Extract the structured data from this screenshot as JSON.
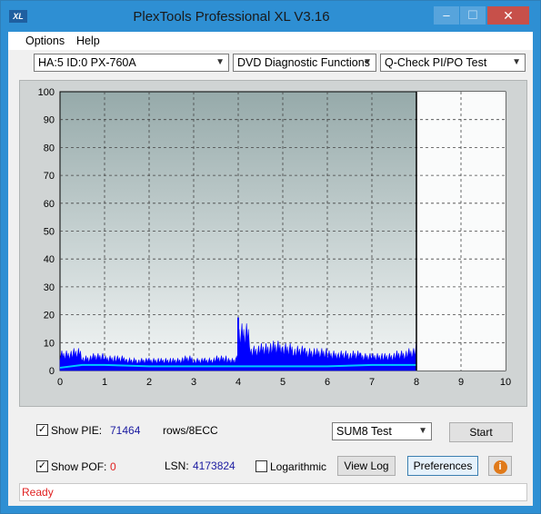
{
  "window": {
    "title": "PlexTools Professional XL V3.16",
    "icon_text": "XL"
  },
  "title_controls": {
    "minimize": "–",
    "maximize": "☐",
    "close": "✕"
  },
  "menu": {
    "options": "Options",
    "help": "Help"
  },
  "combos": {
    "drive": "HA:5 ID:0  PX-760A",
    "function": "DVD Diagnostic Functions",
    "test": "Q-Check PI/PO Test"
  },
  "chart_data": {
    "type": "area",
    "title": "",
    "xlabel": "",
    "ylabel": "",
    "xlim": [
      0,
      10
    ],
    "ylim": [
      0,
      100
    ],
    "x_ticks": [
      "0",
      "1",
      "2",
      "3",
      "4",
      "5",
      "6",
      "7",
      "8",
      "9",
      "10"
    ],
    "y_ticks": [
      "0",
      "10",
      "20",
      "30",
      "40",
      "50",
      "60",
      "70",
      "80",
      "90",
      "100"
    ],
    "grid": true,
    "end_marker_x": 8,
    "series": [
      {
        "color": "#0000ff",
        "x": [
          0.0,
          0.25,
          0.5,
          0.75,
          1.0,
          1.25,
          1.5,
          1.75,
          2.0,
          2.25,
          2.5,
          2.75,
          3.0,
          3.25,
          3.5,
          3.75,
          3.95,
          4.0,
          4.25,
          4.5,
          4.75,
          5.0,
          5.25,
          5.5,
          5.75,
          6.0,
          6.25,
          6.5,
          6.75,
          7.0,
          7.25,
          7.5,
          7.75,
          8.0
        ],
        "values": [
          8,
          9,
          6,
          7,
          6,
          6,
          5,
          5,
          5,
          5,
          5,
          6,
          5,
          5,
          6,
          5,
          6,
          19,
          10,
          11,
          12,
          11,
          10,
          9,
          9,
          8,
          8,
          8,
          7,
          7,
          7,
          8,
          9,
          12
        ]
      },
      {
        "color": "#00c8ff",
        "x": [
          0,
          0.5,
          1,
          2,
          3,
          3.9,
          4.0,
          5,
          6,
          7,
          8
        ],
        "values": [
          1,
          2,
          2,
          1.5,
          1.5,
          1.5,
          1.5,
          1.5,
          1.5,
          2,
          2
        ]
      }
    ]
  },
  "panel": {
    "show_pie_label": "Show PIE:",
    "pie_value": "71464",
    "pie_unit": "rows/8ECC",
    "show_poe_label": "Show POF:",
    "poe_value": "0",
    "lsn_label": "LSN:",
    "lsn_value": "4173824",
    "log_label": "Logarithmic",
    "sum_test": "SUM8 Test",
    "start": "Start",
    "view_log": "View Log",
    "preferences": "Preferences",
    "check_mark": "✓",
    "info_glyph": "i"
  },
  "status": "Ready"
}
